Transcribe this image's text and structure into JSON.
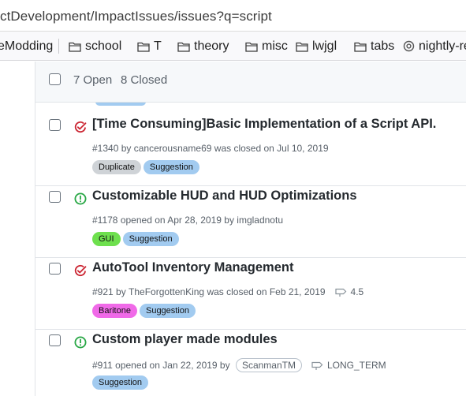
{
  "browser": {
    "url": "ctDevelopment/ImpactIssues/issues?q=script",
    "bookmarks": [
      {
        "label": "eModding",
        "icon": "none"
      },
      {
        "label": "school",
        "icon": "folder-icon"
      },
      {
        "label": "T",
        "icon": "folder-icon"
      },
      {
        "label": "theory",
        "icon": "folder-icon"
      },
      {
        "label": "misc",
        "icon": "folder-icon"
      },
      {
        "label": "lwjgl",
        "icon": "folder-icon"
      },
      {
        "label": "tabs",
        "icon": "folder-icon"
      },
      {
        "label": "nightly-re",
        "icon": "nightly-globe-icon"
      }
    ]
  },
  "issues_header": {
    "open_label": "7 Open",
    "closed_label": "8 Closed"
  },
  "issues": [
    {
      "title": "[Time Consuming]Basic Implementation of a Script API.",
      "state": "closed",
      "number": "#1340",
      "meta_prefix": " by ",
      "author": "cancerousname69",
      "meta_suffix": " was closed on Jul 10, 2019",
      "labels": [
        {
          "name": "Duplicate",
          "color": "#cfd3d7"
        },
        {
          "name": "Suggestion",
          "color": "#a2cbf0"
        }
      ]
    },
    {
      "title": "Customizable HUD and HUD Optimizations",
      "state": "open",
      "number": "#1178",
      "meta_prefix": " opened on Apr 28, 2019 by ",
      "author": "imgladnotu",
      "meta_suffix": "",
      "labels": [
        {
          "name": "GUI",
          "color": "#6ee04e"
        },
        {
          "name": "Suggestion",
          "color": "#a2cbf0"
        }
      ]
    },
    {
      "title": "AutoTool Inventory Management",
      "state": "closed",
      "number": "#921",
      "meta_prefix": " by ",
      "author": "TheForgottenKing",
      "meta_suffix": " was closed on Feb 21, 2019",
      "milestone": "4.5",
      "labels": [
        {
          "name": "Baritone",
          "color": "#f06ae8"
        },
        {
          "name": "Suggestion",
          "color": "#a2cbf0"
        }
      ]
    },
    {
      "title": "Custom player made modules",
      "state": "open",
      "number": "#911",
      "meta_prefix": " opened on Jan 22, 2019 by ",
      "author": "",
      "meta_suffix": "",
      "assignee_chip": "ScanmanTM",
      "milestone": "LONG_TERM",
      "labels": [
        {
          "name": "Suggestion",
          "color": "#a2cbf0"
        }
      ]
    }
  ],
  "colors": {
    "open_icon": "#28a745",
    "closed_icon": "#cb2431",
    "header_bg": "#f6f8fa",
    "border": "#e1e4e8",
    "muted_text": "#586069"
  }
}
